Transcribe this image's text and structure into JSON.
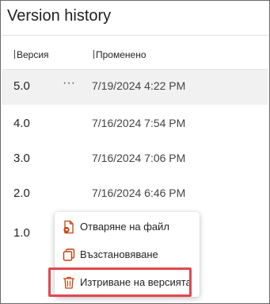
{
  "panel": {
    "title": "Version history"
  },
  "columns": {
    "version": "Версия",
    "modified": "Променено"
  },
  "versions": [
    {
      "version": "5.0",
      "modified": "7/19/2024 4:22 PM",
      "selected": true,
      "more": "···"
    },
    {
      "version": "4.0",
      "modified": "7/16/2024 7:54 PM"
    },
    {
      "version": "3.0",
      "modified": "7/16/2024 7:06 PM"
    },
    {
      "version": "2.0",
      "modified": "7/16/2024 6:46 PM"
    },
    {
      "version": "1.0",
      "modified": ""
    }
  ],
  "context_menu": {
    "items": [
      {
        "label": "Отваряне на файл",
        "icon": "open-file-icon"
      },
      {
        "label": "Възстановяване",
        "icon": "restore-icon"
      },
      {
        "label": "Изтриване на версията",
        "icon": "trash-icon"
      }
    ]
  },
  "colors": {
    "accent_icon": "#c4410c",
    "highlight": "#e0484f",
    "selected_row": "#f1f1f1"
  }
}
